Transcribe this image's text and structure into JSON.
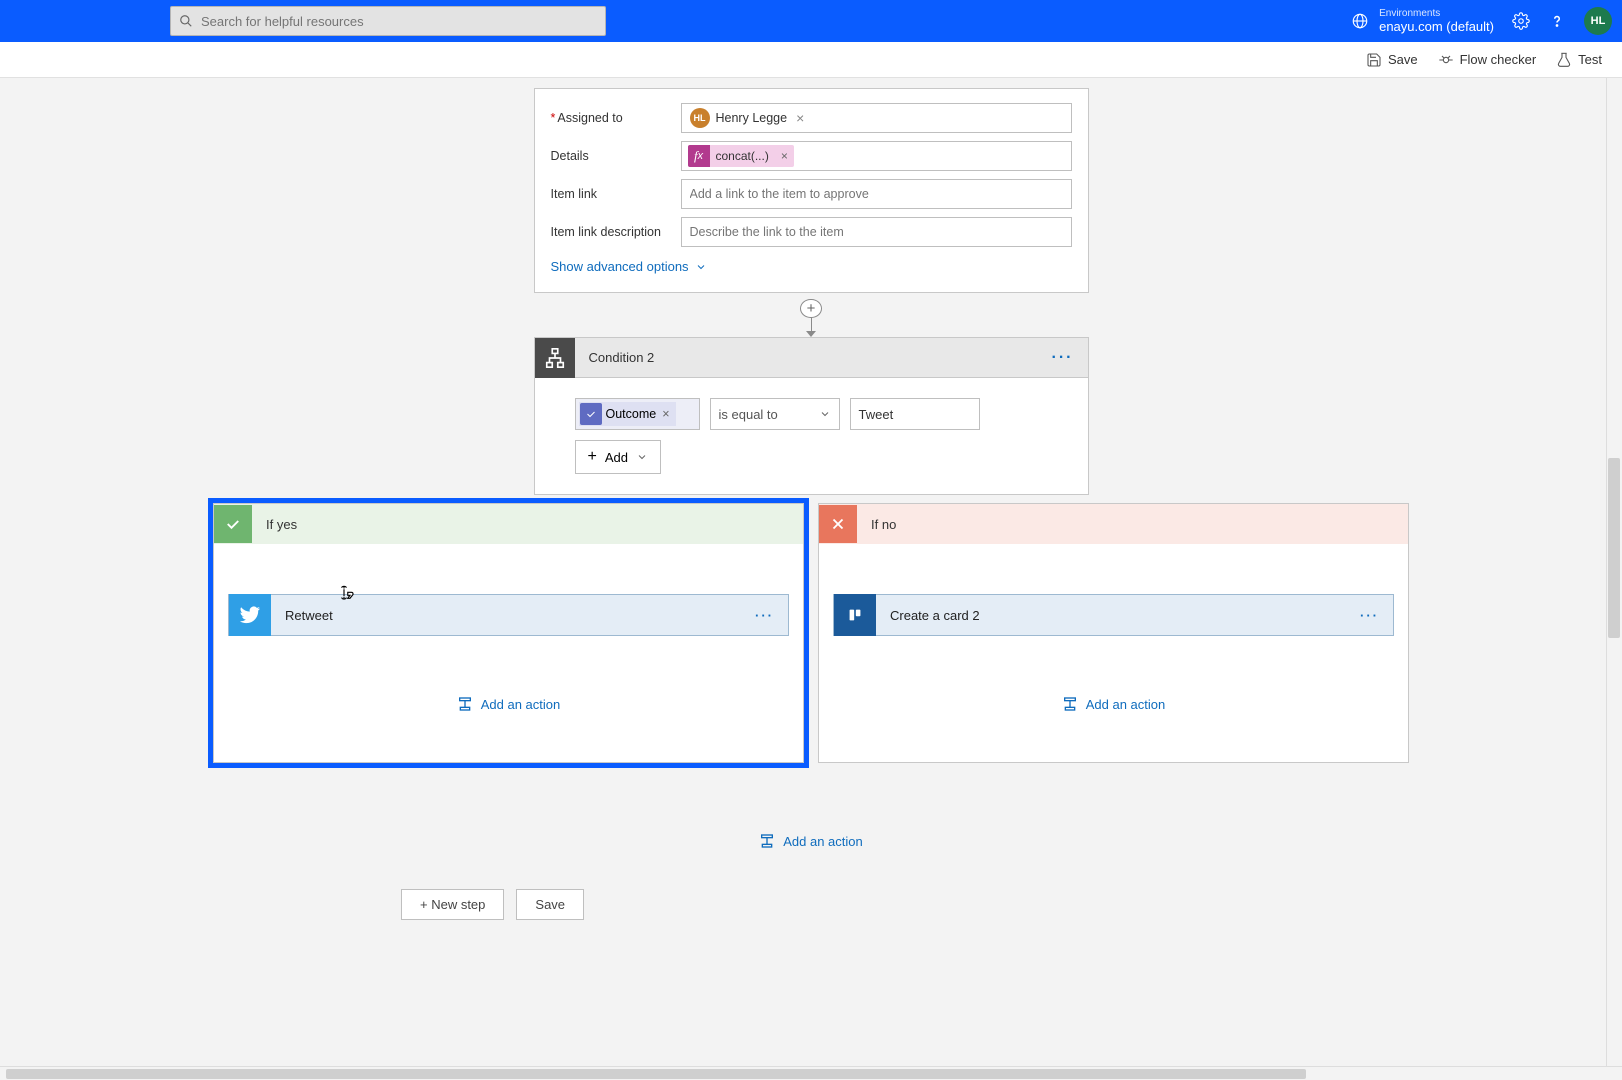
{
  "header": {
    "search_placeholder": "Search for helpful resources",
    "env_label": "Environments",
    "env_name": "enayu.com (default)",
    "avatar_initials": "HL"
  },
  "cmdbar": {
    "save": "Save",
    "flow_checker": "Flow checker",
    "test": "Test"
  },
  "approval": {
    "fields": {
      "assigned_to": {
        "label": "Assigned to",
        "required": true,
        "value_name": "Henry Legge",
        "value_initials": "HL"
      },
      "details": {
        "label": "Details",
        "fx_text": "concat(...)"
      },
      "item_link": {
        "label": "Item link",
        "placeholder": "Add a link to the item to approve"
      },
      "item_link_desc": {
        "label": "Item link description",
        "placeholder": "Describe the link to the item"
      }
    },
    "advanced_link": "Show advanced options"
  },
  "condition": {
    "title": "Condition 2",
    "token": "Outcome",
    "operator": "is equal to",
    "value": "Tweet",
    "add_label": "Add"
  },
  "branches": {
    "yes": {
      "title": "If yes",
      "action_title": "Retweet",
      "add_action": "Add an action"
    },
    "no": {
      "title": "If no",
      "action_title": "Create a card 2",
      "add_action": "Add an action"
    }
  },
  "bottom_add": "Add an action",
  "footer": {
    "new_step": "+ New step",
    "save": "Save"
  }
}
